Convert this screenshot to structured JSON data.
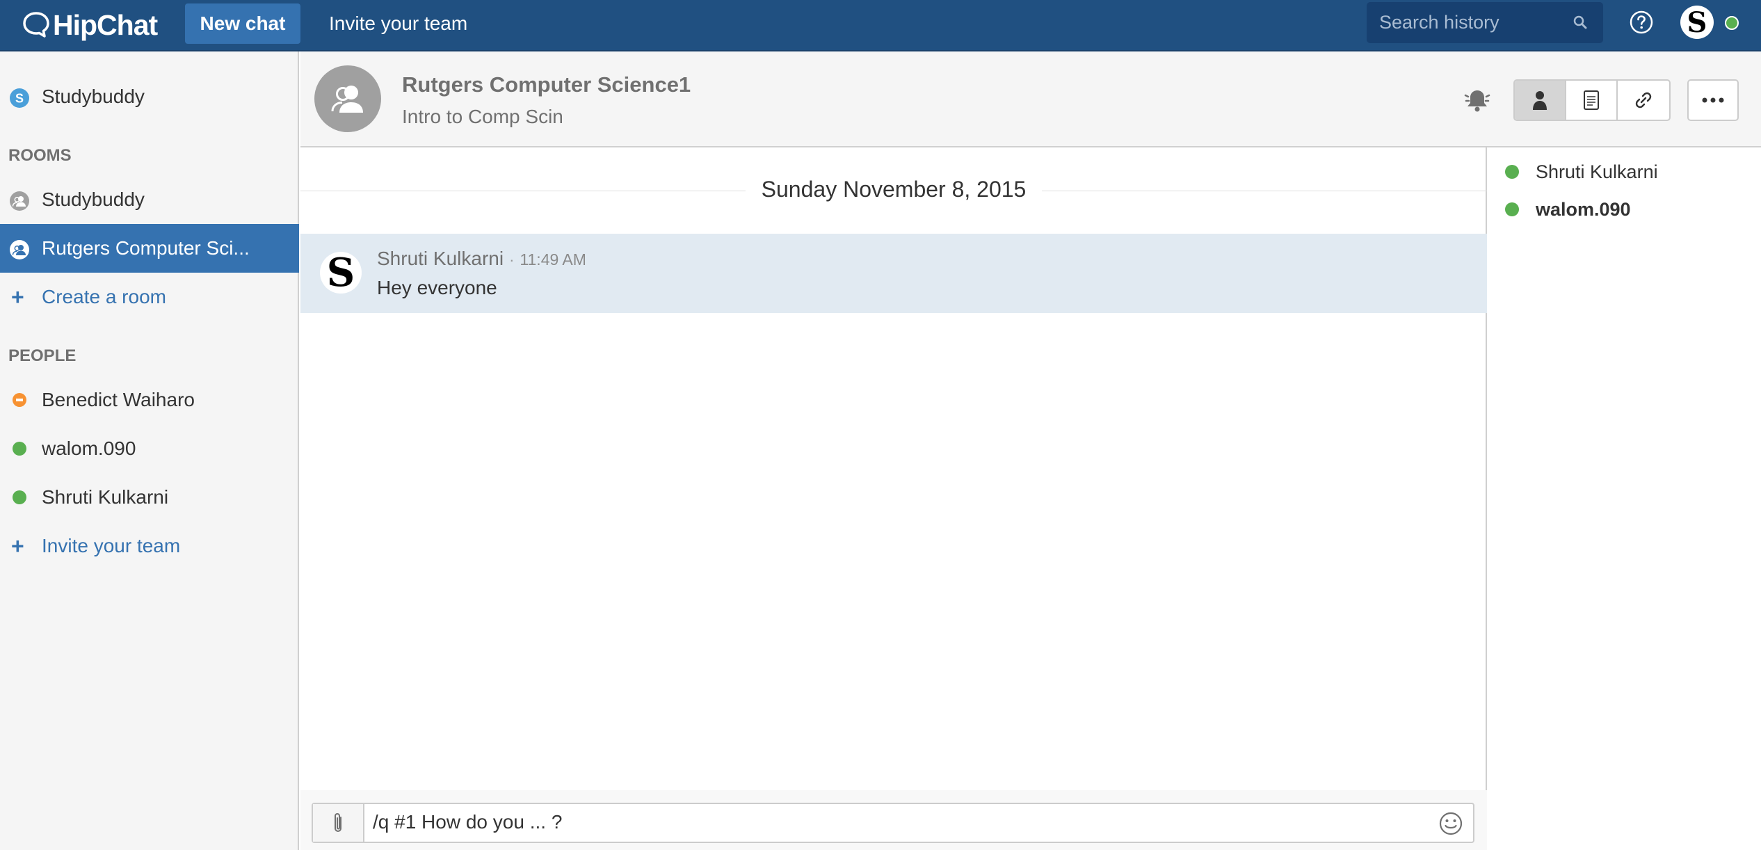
{
  "topbar": {
    "logo_text": "HipChat",
    "new_chat_label": "New chat",
    "invite_label": "Invite your team",
    "search_placeholder": "Search history",
    "user_initial": "S"
  },
  "sidebar": {
    "lobby_label": "Studybuddy",
    "lobby_initial": "S",
    "rooms_heading": "ROOMS",
    "rooms": [
      {
        "label": "Studybuddy"
      },
      {
        "label": "Rutgers Computer Sci..."
      }
    ],
    "create_room_label": "Create a room",
    "people_heading": "PEOPLE",
    "people": [
      {
        "label": "Benedict Waiharo",
        "status": "dnd"
      },
      {
        "label": "walom.090",
        "status": "online"
      },
      {
        "label": "Shruti Kulkarni",
        "status": "online"
      }
    ],
    "invite_label": "Invite your team"
  },
  "room": {
    "title": "Rutgers Computer Science1",
    "topic": "Intro to Comp Scin"
  },
  "chat": {
    "date": "Sunday November 8, 2015",
    "messages": [
      {
        "author": "Shruti Kulkarni",
        "separator": "·",
        "time": "11:49 AM",
        "text": "Hey everyone",
        "initial": "S"
      }
    ]
  },
  "roster": [
    {
      "label": "Shruti Kulkarni"
    },
    {
      "label": "walom.090"
    }
  ],
  "composer": {
    "value": "/q #1 How do you ... ?"
  },
  "colors": {
    "topbar": "#205081",
    "accent": "#3572b0",
    "online": "#59af50",
    "dnd": "#f79232",
    "message_highlight": "#e1eaf2"
  }
}
